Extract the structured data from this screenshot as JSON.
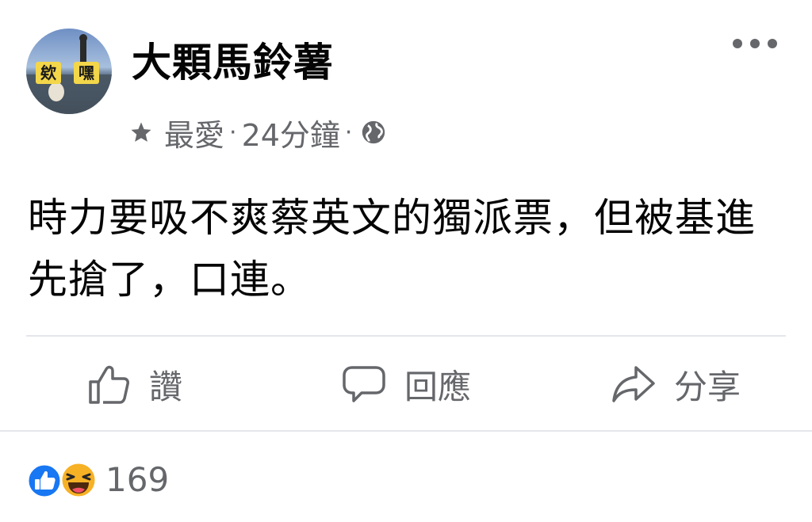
{
  "author": {
    "name": "大顆馬鈴薯",
    "avatar_text_left": "欸",
    "avatar_text_right": "嘿"
  },
  "meta": {
    "audience_label": "最愛",
    "separator": "·",
    "timestamp": "24分鐘",
    "privacy_icon": "globe-icon",
    "favorite_icon": "star-icon"
  },
  "post": {
    "text": "時力要吸不爽蔡英文的獨派票，但被基進先搶了，口連。"
  },
  "actions": {
    "like_label": "讚",
    "comment_label": "回應",
    "share_label": "分享"
  },
  "reactions": {
    "count": "169",
    "types": [
      "like-icon",
      "haha-icon"
    ]
  },
  "colors": {
    "secondary_text": "#65676b",
    "primary_text": "#050505",
    "like_blue": "#1877f2",
    "haha_yellow": "#f7b125",
    "divider": "#e4e6eb"
  }
}
